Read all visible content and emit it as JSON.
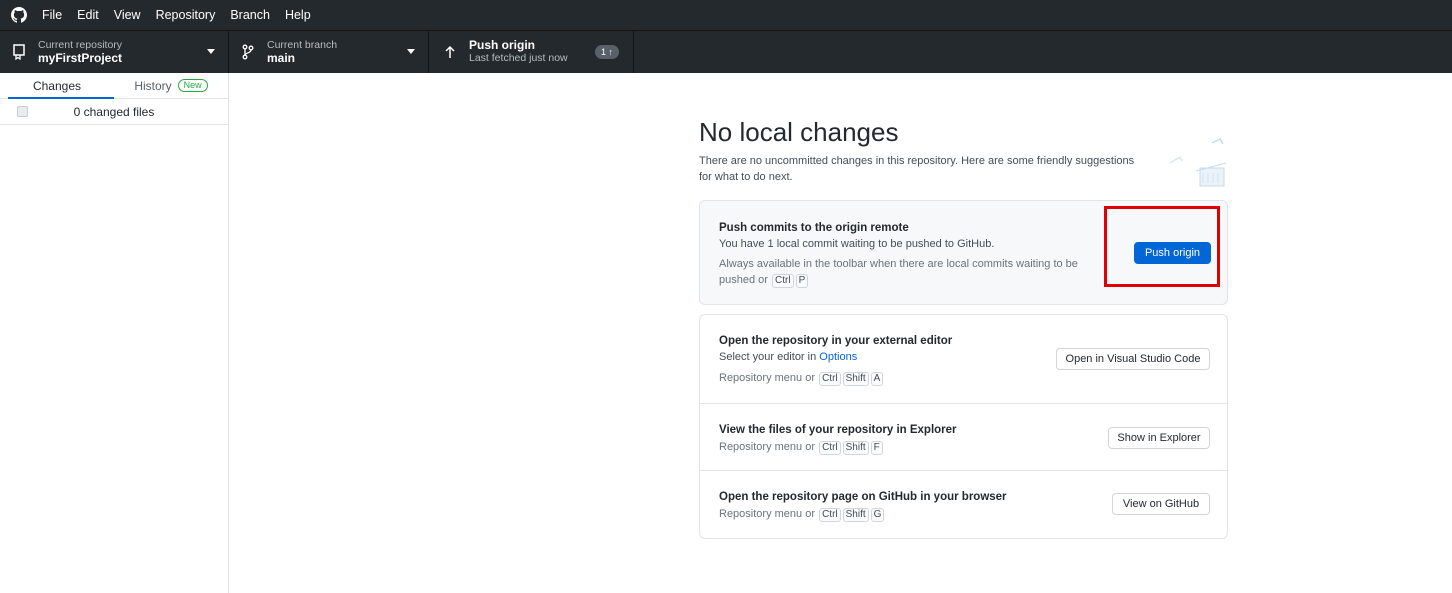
{
  "menubar": {
    "items": [
      "File",
      "Edit",
      "View",
      "Repository",
      "Branch",
      "Help"
    ]
  },
  "toolbar": {
    "repo_label": "Current repository",
    "repo_value": "myFirstProject",
    "branch_label": "Current branch",
    "branch_value": "main",
    "push_title": "Push origin",
    "push_sub": "Last fetched just now",
    "push_badge": "1 ↑"
  },
  "sidebar": {
    "tab_changes": "Changes",
    "tab_history": "History",
    "new_badge": "New",
    "changed_files": "0 changed files"
  },
  "main": {
    "heading": "No local changes",
    "subtitle": "There are no uncommitted changes in this repository. Here are some friendly suggestions for what to do next.",
    "push_card": {
      "title": "Push commits to the origin remote",
      "desc": "You have 1 local commit waiting to be pushed to GitHub.",
      "hint_prefix": "Always available in the toolbar when there are local commits waiting to be pushed or",
      "keys": [
        "Ctrl",
        "P"
      ],
      "button": "Push origin"
    },
    "editor_card": {
      "title": "Open the repository in your external editor",
      "desc_prefix": "Select your editor in",
      "desc_link": "Options",
      "hint_prefix": "Repository menu or",
      "keys": [
        "Ctrl",
        "Shift",
        "A"
      ],
      "button": "Open in Visual Studio Code"
    },
    "explorer_card": {
      "title": "View the files of your repository in Explorer",
      "hint_prefix": "Repository menu or",
      "keys": [
        "Ctrl",
        "Shift",
        "F"
      ],
      "button": "Show in Explorer"
    },
    "github_card": {
      "title": "Open the repository page on GitHub in your browser",
      "hint_prefix": "Repository menu or",
      "keys": [
        "Ctrl",
        "Shift",
        "G"
      ],
      "button": "View on GitHub"
    }
  },
  "colors": {
    "toolbar_bg": "#24292e",
    "accent": "#0366d6",
    "highlight": "#e00000"
  }
}
